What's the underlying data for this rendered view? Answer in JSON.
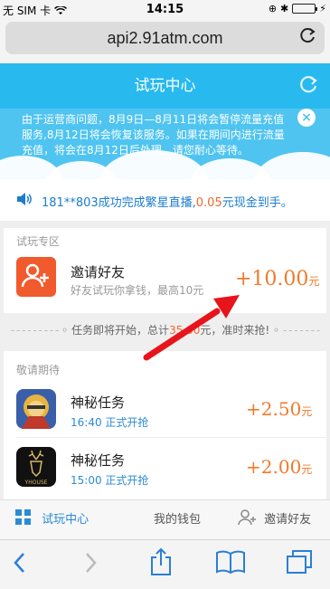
{
  "status_bar": {
    "carrier": "无 SIM 卡",
    "time": "14:15"
  },
  "browser": {
    "url": "api2.91atm.com",
    "reload_glyph": "C"
  },
  "header": {
    "title": "试玩中心"
  },
  "notice": {
    "text": "由于运营商问题，8月9日—8月11日将会暂停流量充值服务,8月12日将会恢复该服务。如果在期间内进行流量充值，将会在8月12日后处理，请您耐心等待。",
    "close_glyph": "×"
  },
  "marquee": {
    "prefix": "181**803成功完成繁星直播,",
    "amount": "0.05",
    "suffix": "元现金到手。"
  },
  "trial_section": {
    "title": "试玩专区",
    "item": {
      "name": "邀请好友",
      "desc": "好友试玩你拿钱，最高10元",
      "reward": "+10.00",
      "unit": "元"
    }
  },
  "countdown": {
    "dashes_left": "- - - - - - - - -",
    "prefix": "任务即将开始，总计",
    "amount": "35.00",
    "suffix": "元，准时来抢!",
    "dashes_right": "- - - - - - -"
  },
  "upcoming_section": {
    "title": "敬请期待",
    "tasks": [
      {
        "name": "神秘任务",
        "time": "16:40 正式开抢",
        "reward": "+2.50",
        "unit": "元",
        "icon": "game-hero-icon"
      },
      {
        "name": "神秘任务",
        "time": "15:00 正式开抢",
        "reward": "+2.00",
        "unit": "元",
        "icon": "yhouse-deer-icon"
      }
    ]
  },
  "tabs": [
    {
      "label": "试玩中心",
      "icon": "grid-icon",
      "active": true
    },
    {
      "label": "我的钱包",
      "icon": "",
      "active": false
    },
    {
      "label": "邀请好友",
      "icon": "add-user-icon",
      "active": false
    }
  ],
  "colors": {
    "header_blue": "#28b9ef",
    "reward_orange": "#f07a2b",
    "link_blue": "#2a8bd6",
    "invite_icon_bg": "#f05a2d",
    "arrow_red": "#e8141c"
  }
}
